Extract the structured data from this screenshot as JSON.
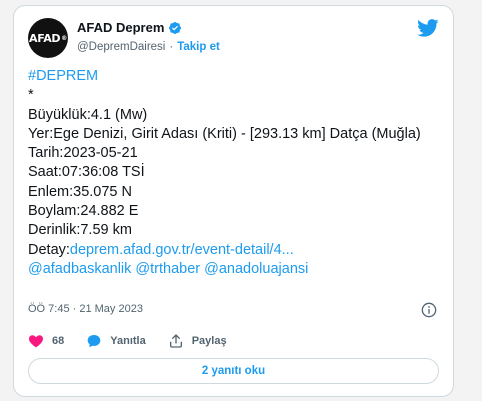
{
  "author": {
    "avatar_text": "AFAD",
    "display_name": "AFAD Deprem",
    "handle": "@DepremDairesi",
    "separator": "·",
    "follow_label": "Takip et"
  },
  "tweet": {
    "hashtag": "#DEPREM",
    "star": "*",
    "lines": {
      "magnitude": "Büyüklük:4.1 (Mw)",
      "location": "Yer:Ege Denizi, Girit Adası (Kriti) - [293.13 km] Datça (Muğla)",
      "date": "Tarih:2023-05-21",
      "time": "Saat:07:36:08 TSİ",
      "latitude": "Enlem:35.075 N",
      "longitude": "Boylam:24.882 E",
      "depth": "Derinlik:7.59 km"
    },
    "detail_label": "Detay:",
    "detail_link": "deprem.afad.gov.tr/event-detail/4...",
    "mentions": "@afadbaskanlik @trthaber @anadoluajansi",
    "timestamp": "ÖÖ 7:45 · 21 May 2023"
  },
  "actions": {
    "like_count": "68",
    "reply_label": "Yanıtla",
    "share_label": "Paylaş"
  },
  "replies_button": "2 yanıtı oku",
  "colors": {
    "accent": "#1d9bf0",
    "like": "#f91880",
    "text": "#0f1419",
    "muted": "#536471"
  }
}
